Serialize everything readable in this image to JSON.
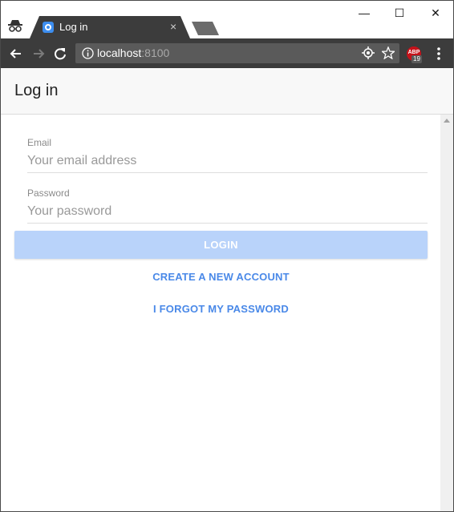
{
  "browser": {
    "tab": {
      "title": "Log in",
      "close": "×"
    },
    "window_controls": {
      "minimize": "—",
      "maximize": "☐",
      "close": "✕"
    },
    "omnibox": {
      "host": "localhost",
      "port": ":8100"
    },
    "extension": {
      "label": "ABP",
      "count": "19"
    }
  },
  "page": {
    "header": {
      "title": "Log in"
    },
    "form": {
      "email": {
        "label": "Email",
        "placeholder": "Your email address",
        "value": ""
      },
      "password": {
        "label": "Password",
        "placeholder": "Your password",
        "value": ""
      },
      "login_label": "LOGIN",
      "create_account_label": "CREATE A NEW ACCOUNT",
      "forgot_password_label": "I FORGOT MY PASSWORD"
    }
  },
  "colors": {
    "toolbar": "#3c3c3c",
    "omnibox": "#5a5a5a",
    "primary_disabled": "#b9d3fa",
    "link": "#4a89e8"
  }
}
